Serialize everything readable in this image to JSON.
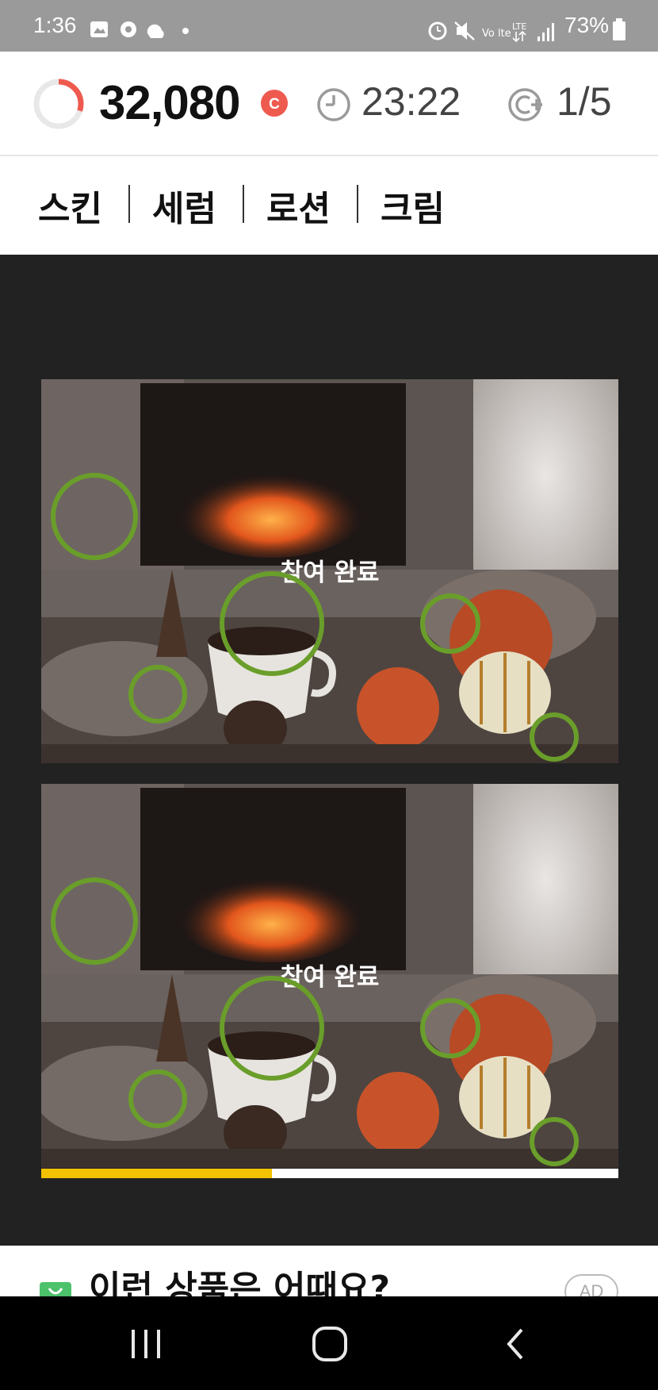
{
  "status_bar": {
    "time": "1:36",
    "battery": "73%",
    "network": "LTE"
  },
  "header": {
    "points": "32,080",
    "coin_badge": "C",
    "timer": "23:22",
    "progress": "1/5",
    "ring_progress": 0.3
  },
  "categories": [
    {
      "label": "스킨"
    },
    {
      "label": "세럼"
    },
    {
      "label": "로션"
    },
    {
      "label": "크림"
    }
  ],
  "game": {
    "top_panel_label": "참여 완료",
    "bottom_panel_label": "참여 완료",
    "progress_fraction": 0.4
  },
  "ad": {
    "title": "이런 상품은 어때요?",
    "badge": "AD"
  },
  "colors": {
    "accent_red": "#ef5a4f",
    "circle_green": "#6a9e2a",
    "progress_yellow": "#f2c200"
  },
  "icons": {
    "nav_recent": "recent-apps-icon",
    "nav_home": "home-icon",
    "nav_back": "back-icon"
  }
}
